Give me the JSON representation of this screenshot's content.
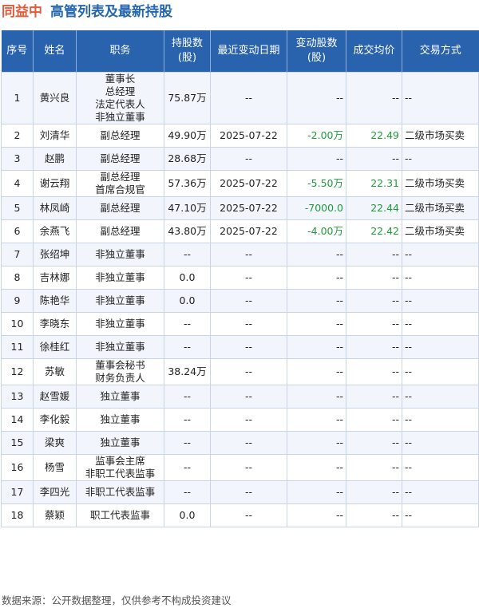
{
  "header": {
    "company": "同益中",
    "subject": "高管列表及最新持股"
  },
  "table": {
    "columns": [
      "序号",
      "姓名",
      "职务",
      "持股数\n(股)",
      "最近变动日期",
      "变动股数\n(股)",
      "成交均价",
      "交易方式"
    ],
    "rows": [
      {
        "idx": "1",
        "name": "黄兴良",
        "positions": [
          "董事长",
          "总经理",
          "法定代表人",
          "非独立董事"
        ],
        "shares": "75.87万",
        "date": "--",
        "change": "--",
        "price": "--",
        "method": "--"
      },
      {
        "idx": "2",
        "name": "刘清华",
        "positions": [
          "副总经理"
        ],
        "shares": "49.90万",
        "date": "2025-07-22",
        "change": "-2.00万",
        "price": "22.49",
        "method": "二级市场买卖"
      },
      {
        "idx": "3",
        "name": "赵鹏",
        "positions": [
          "副总经理"
        ],
        "shares": "28.68万",
        "date": "--",
        "change": "--",
        "price": "--",
        "method": "--"
      },
      {
        "idx": "4",
        "name": "谢云翔",
        "positions": [
          "副总经理",
          "首席合规官"
        ],
        "shares": "57.36万",
        "date": "2025-07-22",
        "change": "-5.50万",
        "price": "22.31",
        "method": "二级市场买卖"
      },
      {
        "idx": "5",
        "name": "林凤崎",
        "positions": [
          "副总经理"
        ],
        "shares": "47.10万",
        "date": "2025-07-22",
        "change": "-7000.0",
        "price": "22.44",
        "method": "二级市场买卖"
      },
      {
        "idx": "6",
        "name": "余燕飞",
        "positions": [
          "副总经理"
        ],
        "shares": "43.80万",
        "date": "2025-07-22",
        "change": "-4.00万",
        "price": "22.42",
        "method": "二级市场买卖"
      },
      {
        "idx": "7",
        "name": "张绍坤",
        "positions": [
          "非独立董事"
        ],
        "shares": "--",
        "date": "--",
        "change": "--",
        "price": "--",
        "method": "--"
      },
      {
        "idx": "8",
        "name": "吉林娜",
        "positions": [
          "非独立董事"
        ],
        "shares": "0.0",
        "date": "--",
        "change": "--",
        "price": "--",
        "method": "--"
      },
      {
        "idx": "9",
        "name": "陈艳华",
        "positions": [
          "非独立董事"
        ],
        "shares": "0.0",
        "date": "--",
        "change": "--",
        "price": "--",
        "method": "--"
      },
      {
        "idx": "10",
        "name": "李晓东",
        "positions": [
          "非独立董事"
        ],
        "shares": "--",
        "date": "--",
        "change": "--",
        "price": "--",
        "method": "--"
      },
      {
        "idx": "11",
        "name": "徐桂红",
        "positions": [
          "非独立董事"
        ],
        "shares": "--",
        "date": "--",
        "change": "--",
        "price": "--",
        "method": "--"
      },
      {
        "idx": "12",
        "name": "苏敏",
        "positions": [
          "董事会秘书",
          "财务负责人"
        ],
        "shares": "38.24万",
        "date": "--",
        "change": "--",
        "price": "--",
        "method": "--"
      },
      {
        "idx": "13",
        "name": "赵雪媛",
        "positions": [
          "独立董事"
        ],
        "shares": "--",
        "date": "--",
        "change": "--",
        "price": "--",
        "method": "--"
      },
      {
        "idx": "14",
        "name": "李化毅",
        "positions": [
          "独立董事"
        ],
        "shares": "--",
        "date": "--",
        "change": "--",
        "price": "--",
        "method": "--"
      },
      {
        "idx": "15",
        "name": "梁爽",
        "positions": [
          "独立董事"
        ],
        "shares": "--",
        "date": "--",
        "change": "--",
        "price": "--",
        "method": "--"
      },
      {
        "idx": "16",
        "name": "杨雪",
        "positions": [
          "监事会主席",
          "非职工代表监事"
        ],
        "shares": "--",
        "date": "--",
        "change": "--",
        "price": "--",
        "method": "--"
      },
      {
        "idx": "17",
        "name": "李四光",
        "positions": [
          "非职工代表监事"
        ],
        "shares": "--",
        "date": "--",
        "change": "--",
        "price": "--",
        "method": "--"
      },
      {
        "idx": "18",
        "name": "蔡颖",
        "positions": [
          "职工代表监事"
        ],
        "shares": "0.0",
        "date": "--",
        "change": "--",
        "price": "--",
        "method": "--"
      }
    ]
  },
  "footnote": "数据来源：公开数据整理，仅供参考不构成投资建议",
  "colors": {
    "header_bg": "#2962ad",
    "company": "#e25a3a",
    "subject": "#2467b0",
    "negative": "#1e9c3a"
  }
}
